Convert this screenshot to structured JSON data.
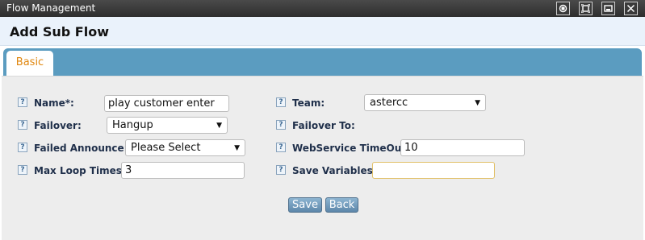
{
  "window": {
    "title": "Flow Management"
  },
  "page": {
    "title": "Add Sub Flow"
  },
  "tabs": [
    {
      "label": "Basic"
    }
  ],
  "help_glyph": "?",
  "form": {
    "name": {
      "label": "Name*:",
      "value": "play customer enter"
    },
    "team": {
      "label": "Team:",
      "value": "astercc"
    },
    "failover": {
      "label": "Failover:",
      "value": "Hangup"
    },
    "failover_to": {
      "label": "Failover To:"
    },
    "failed_announce": {
      "label": "Failed Announce:",
      "value": "Please Select"
    },
    "webservice_timeout": {
      "label": "WebService TimeOut:",
      "value": "10"
    },
    "max_loop_times": {
      "label": "Max Loop Times:",
      "value": "3"
    },
    "save_variables": {
      "label": "Save Variables:",
      "value": ""
    }
  },
  "buttons": {
    "save": "Save",
    "back": "Back"
  },
  "icons": {
    "window_controls": [
      "restore-icon",
      "maximize-icon",
      "minimize-icon",
      "close-icon"
    ],
    "dropdown": "chevron-down-icon",
    "help": "help-icon"
  },
  "colors": {
    "titlebar": "#3a3a3a",
    "tabbar": "#5b9cc0",
    "tab_text": "#e0870f",
    "panel": "#ededed",
    "button": "#6f97b8"
  }
}
